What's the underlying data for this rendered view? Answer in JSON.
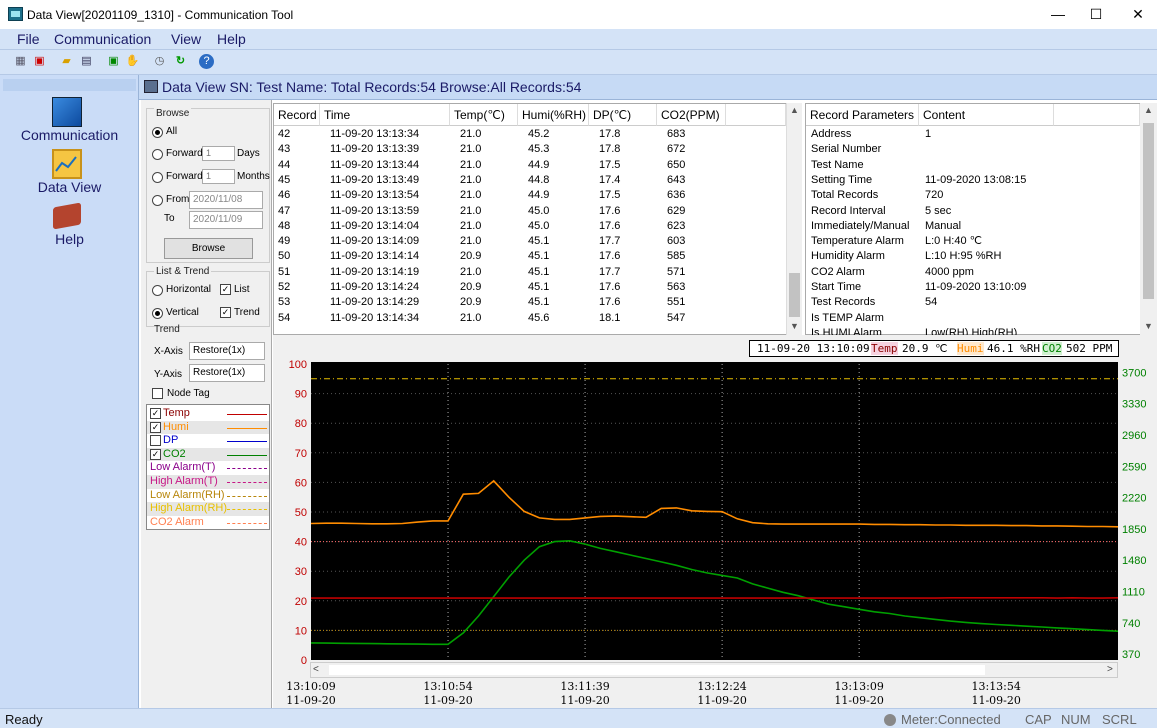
{
  "window": {
    "title": "Data View[20201109_1310] - Communication Tool",
    "minimize": "—",
    "maximize": "☐",
    "close": "✕"
  },
  "menu": [
    "File",
    "Communication",
    "View",
    "Help"
  ],
  "toolbar": [
    "grid-icon",
    "delete-icon",
    "open-icon",
    "save-icon",
    "export-icon",
    "hand-icon",
    "clock-icon",
    "refresh-icon",
    "help-icon"
  ],
  "nav": {
    "items": [
      {
        "label": "Communication",
        "icon": "computer-icon"
      },
      {
        "label": "Data View",
        "icon": "chart-icon"
      },
      {
        "label": "Help",
        "icon": "book-icon"
      }
    ]
  },
  "dataview": {
    "title": "Data View  SN: Test Name:  Total Records:54 Browse:All Records:54"
  },
  "browse": {
    "label": "Browse",
    "all": "All",
    "forward": "Forward",
    "forward_days_value": "1",
    "days": "Days",
    "forward_months_value": "1",
    "months": "Months",
    "from": "From",
    "from_value": "2020/11/08",
    "to": "To",
    "to_value": "2020/11/09",
    "button": "Browse",
    "selected": "All"
  },
  "list_trend": {
    "label": "List & Trend",
    "horizontal": "Horizontal",
    "vertical": "Vertical",
    "list": "List",
    "trend": "Trend",
    "orientation": "Vertical",
    "list_checked": true,
    "trend_checked": true
  },
  "trend": {
    "label": "Trend",
    "x_axis_label": "X-Axis",
    "x_axis_value": "Restore(1x)",
    "y_axis_label": "Y-Axis",
    "y_axis_value": "Restore(1x)",
    "node_tag": "Node Tag",
    "node_tag_checked": false
  },
  "legend": [
    {
      "label": "Temp",
      "checked": true,
      "color": "#c00000",
      "style": "solid",
      "text_color": "#8b0000"
    },
    {
      "label": "Humi",
      "checked": true,
      "color": "#ff8c00",
      "style": "solid",
      "text_color": "#ff8c00"
    },
    {
      "label": "DP",
      "checked": false,
      "color": "#0000cc",
      "style": "solid",
      "text_color": "#0000cc"
    },
    {
      "label": "CO2",
      "checked": true,
      "color": "#008000",
      "style": "solid",
      "text_color": "#008000"
    },
    {
      "label": "Low Alarm(T)",
      "checked": null,
      "color": "#8b008b",
      "style": "dash",
      "text_color": "#8b008b"
    },
    {
      "label": "High Alarm(T)",
      "checked": null,
      "color": "#c71585",
      "style": "dashdot",
      "text_color": "#c71585"
    },
    {
      "label": "Low Alarm(RH)",
      "checked": null,
      "color": "#b8860b",
      "style": "dash",
      "text_color": "#b8860b"
    },
    {
      "label": "High Alarm(RH)",
      "checked": null,
      "color": "#e8c000",
      "style": "dashdot",
      "text_color": "#e8c000"
    },
    {
      "label": "CO2 Alarm",
      "checked": null,
      "color": "#ff7f50",
      "style": "dash",
      "text_color": "#ff7f50"
    }
  ],
  "table": {
    "columns": [
      "Record",
      "Time",
      "Temp(℃)",
      "Humi(%RH)",
      "DP(℃)",
      "CO2(PPM)"
    ],
    "rows": [
      [
        "42",
        "11-09-20 13:13:34",
        "21.0",
        "45.2",
        "17.8",
        "683"
      ],
      [
        "43",
        "11-09-20 13:13:39",
        "21.0",
        "45.3",
        "17.8",
        "672"
      ],
      [
        "44",
        "11-09-20 13:13:44",
        "21.0",
        "44.9",
        "17.5",
        "650"
      ],
      [
        "45",
        "11-09-20 13:13:49",
        "21.0",
        "44.8",
        "17.4",
        "643"
      ],
      [
        "46",
        "11-09-20 13:13:54",
        "21.0",
        "44.9",
        "17.5",
        "636"
      ],
      [
        "47",
        "11-09-20 13:13:59",
        "21.0",
        "45.0",
        "17.6",
        "629"
      ],
      [
        "48",
        "11-09-20 13:14:04",
        "21.0",
        "45.0",
        "17.6",
        "623"
      ],
      [
        "49",
        "11-09-20 13:14:09",
        "21.0",
        "45.1",
        "17.7",
        "603"
      ],
      [
        "50",
        "11-09-20 13:14:14",
        "20.9",
        "45.1",
        "17.6",
        "585"
      ],
      [
        "51",
        "11-09-20 13:14:19",
        "21.0",
        "45.1",
        "17.7",
        "571"
      ],
      [
        "52",
        "11-09-20 13:14:24",
        "20.9",
        "45.1",
        "17.6",
        "563"
      ],
      [
        "53",
        "11-09-20 13:14:29",
        "20.9",
        "45.1",
        "17.6",
        "551"
      ],
      [
        "54",
        "11-09-20 13:14:34",
        "21.0",
        "45.6",
        "18.1",
        "547"
      ]
    ]
  },
  "params": {
    "columns": [
      "Record Parameters",
      "Content"
    ],
    "rows": [
      [
        "Address",
        "1"
      ],
      [
        "Serial Number",
        ""
      ],
      [
        "Test Name",
        ""
      ],
      [
        "Setting Time",
        "11-09-2020 13:08:15"
      ],
      [
        "Total Records",
        "720"
      ],
      [
        "Record Interval",
        "5 sec"
      ],
      [
        "Immediately/Manual",
        "Manual"
      ],
      [
        "Temperature Alarm",
        "L:0 H:40 ℃"
      ],
      [
        "Humidity Alarm",
        "L:10 H:95 %RH"
      ],
      [
        "CO2 Alarm",
        "4000 ppm"
      ],
      [
        "Start Time",
        "11-09-2020 13:10:09"
      ],
      [
        "Test Records",
        "54"
      ],
      [
        "Is TEMP Alarm",
        ""
      ],
      [
        "Is HUMI Alarm",
        "Low(RH) High(RH)"
      ]
    ]
  },
  "chart_info": {
    "time": "11-09-20 13:10:09",
    "temp_label": "Temp",
    "temp_value": "20.9 ℃",
    "humi_label": "Humi",
    "humi_value": "46.1 %RH",
    "co2_label": "CO2",
    "co2_value": "502 PPM"
  },
  "chart_data": {
    "type": "line",
    "x": [
      "13:10:09",
      "13:10:14",
      "13:10:19",
      "13:10:24",
      "13:10:29",
      "13:10:34",
      "13:10:39",
      "13:10:44",
      "13:10:49",
      "13:10:54",
      "13:10:59",
      "13:11:04",
      "13:11:09",
      "13:11:14",
      "13:11:19",
      "13:11:24",
      "13:11:29",
      "13:11:34",
      "13:11:39",
      "13:11:44",
      "13:11:49",
      "13:11:54",
      "13:11:59",
      "13:12:04",
      "13:12:09",
      "13:12:14",
      "13:12:19",
      "13:12:24",
      "13:12:29",
      "13:12:34",
      "13:12:39",
      "13:12:44",
      "13:12:49",
      "13:12:54",
      "13:12:59",
      "13:13:04",
      "13:13:09",
      "13:13:14",
      "13:13:19",
      "13:13:24",
      "13:13:29",
      "13:13:34",
      "13:13:39",
      "13:13:44",
      "13:13:49",
      "13:13:54",
      "13:13:59",
      "13:14:04",
      "13:14:09",
      "13:14:14",
      "13:14:19",
      "13:14:24",
      "13:14:29",
      "13:14:34"
    ],
    "x_tick_labels": [
      [
        "13:10:09",
        "11-09-20"
      ],
      [
        "13:10:54",
        "11-09-20"
      ],
      [
        "13:11:39",
        "11-09-20"
      ],
      [
        "13:12:24",
        "11-09-20"
      ],
      [
        "13:13:09",
        "11-09-20"
      ],
      [
        "13:13:54",
        "11-09-20"
      ]
    ],
    "y_left": {
      "ticks": [
        0,
        10,
        20,
        30,
        40,
        50,
        60,
        70,
        80,
        90,
        100
      ],
      "range": [
        0,
        100
      ]
    },
    "y_right": {
      "ticks": [
        370,
        740,
        1110,
        1480,
        1850,
        2220,
        2590,
        2960,
        3330,
        3700
      ],
      "range": [
        300,
        3800
      ]
    },
    "series": [
      {
        "name": "Humi",
        "axis": "left",
        "color": "#ff8c00",
        "values": [
          46.1,
          46.2,
          46.2,
          46.1,
          46.0,
          46.0,
          46.1,
          46.6,
          47.0,
          47.0,
          56.0,
          56.3,
          60.5,
          55.0,
          50.2,
          48.0,
          47.5,
          47.5,
          48.0,
          48.5,
          48.6,
          48.4,
          48.2,
          51.2,
          51.4,
          50.4,
          50.2,
          50.1,
          47.7,
          46.4,
          46.0,
          45.9,
          45.9,
          45.9,
          45.9,
          45.9,
          45.9,
          45.8,
          45.8,
          45.7,
          45.7,
          45.6,
          45.6,
          45.5,
          45.5,
          45.5,
          45.4,
          45.4,
          45.3,
          45.3,
          45.2,
          45.1,
          45.1,
          45.0
        ]
      },
      {
        "name": "CO2",
        "axis": "right",
        "color": "#00a000",
        "values": [
          502,
          500,
          498,
          496,
          494,
          492,
          490,
          488,
          486,
          486,
          620,
          820,
          1050,
          1280,
          1480,
          1640,
          1700,
          1710,
          1670,
          1620,
          1580,
          1540,
          1500,
          1460,
          1420,
          1370,
          1330,
          1300,
          1270,
          1200,
          1150,
          1100,
          1060,
          1010,
          960,
          930,
          900,
          870,
          850,
          820,
          800,
          780,
          760,
          745,
          730,
          720,
          710,
          700,
          690,
          680,
          670,
          660,
          650,
          640
        ]
      },
      {
        "name": "Temp",
        "axis": "left",
        "color": "#c00000",
        "values": [
          20.9,
          20.9,
          20.9,
          20.9,
          20.9,
          20.9,
          20.9,
          20.9,
          20.9,
          20.9,
          20.9,
          20.9,
          20.9,
          20.9,
          20.9,
          20.9,
          20.9,
          20.9,
          20.9,
          20.9,
          20.9,
          20.9,
          20.9,
          20.9,
          20.9,
          20.9,
          20.9,
          20.9,
          20.9,
          20.9,
          20.9,
          20.9,
          20.9,
          20.9,
          20.9,
          20.9,
          20.9,
          20.9,
          20.9,
          20.9,
          20.9,
          20.9,
          21.0,
          21.0,
          21.0,
          21.0,
          21.0,
          21.0,
          21.0,
          20.9,
          21.0,
          20.9,
          20.9,
          21.0
        ]
      }
    ],
    "alarm_lines": [
      {
        "label": "High Alarm(RH)",
        "axis": "left",
        "value": 95,
        "color": "#e8c000",
        "style": "dashdot"
      },
      {
        "label": "High Alarm(T)",
        "axis": "left",
        "value": 40,
        "color": "#ff6666",
        "style": "dot"
      },
      {
        "label": "Low Alarm(RH)",
        "axis": "left",
        "value": 10,
        "color": "#b8860b",
        "style": "dot"
      }
    ],
    "grid": true
  },
  "status": {
    "ready": "Ready",
    "meter": "Meter:Connected",
    "cap": "CAP",
    "num": "NUM",
    "scrl": "SCRL"
  }
}
